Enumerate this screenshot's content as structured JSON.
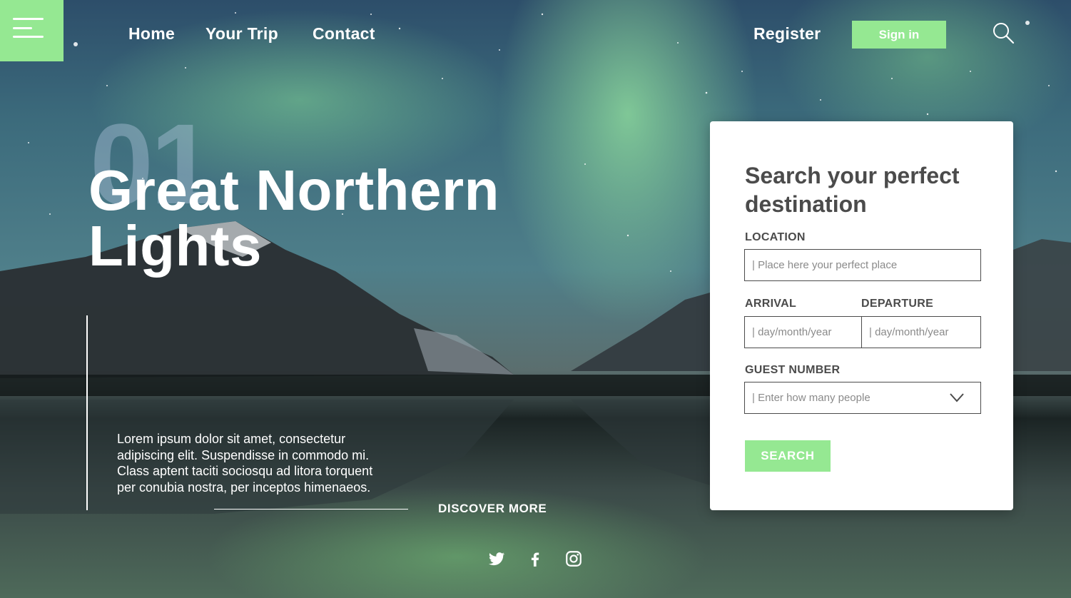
{
  "nav": {
    "home": "Home",
    "your_trip": "Your Trip",
    "contact": "Contact",
    "register": "Register",
    "sign_in": "Sign in"
  },
  "hero": {
    "number": "01",
    "title_line1": "Great Northern",
    "title_line2": "Lights",
    "description": "Lorem ipsum dolor sit amet, consectetur adipiscing elit. Suspendisse in commodo mi. Class aptent taciti sociosqu ad litora torquent per conubia nostra, per inceptos himenaeos.",
    "discover": "DISCOVER MORE"
  },
  "form": {
    "title": "Search your perfect destination",
    "location_label": "LOCATION",
    "location_placeholder": "| Place here your perfect place",
    "arrival_label": "ARRIVAL",
    "arrival_placeholder": "| day/month/year",
    "departure_label": "DEPARTURE",
    "departure_placeholder": "| day/month/year",
    "guest_label": "GUEST NUMBER",
    "guest_placeholder": "| Enter how many people",
    "search_button": "SEARCH"
  },
  "social": [
    "twitter-icon",
    "facebook-icon",
    "instagram-icon"
  ],
  "colors": {
    "accent": "#95e892",
    "text_dark": "#4b4b4b"
  }
}
